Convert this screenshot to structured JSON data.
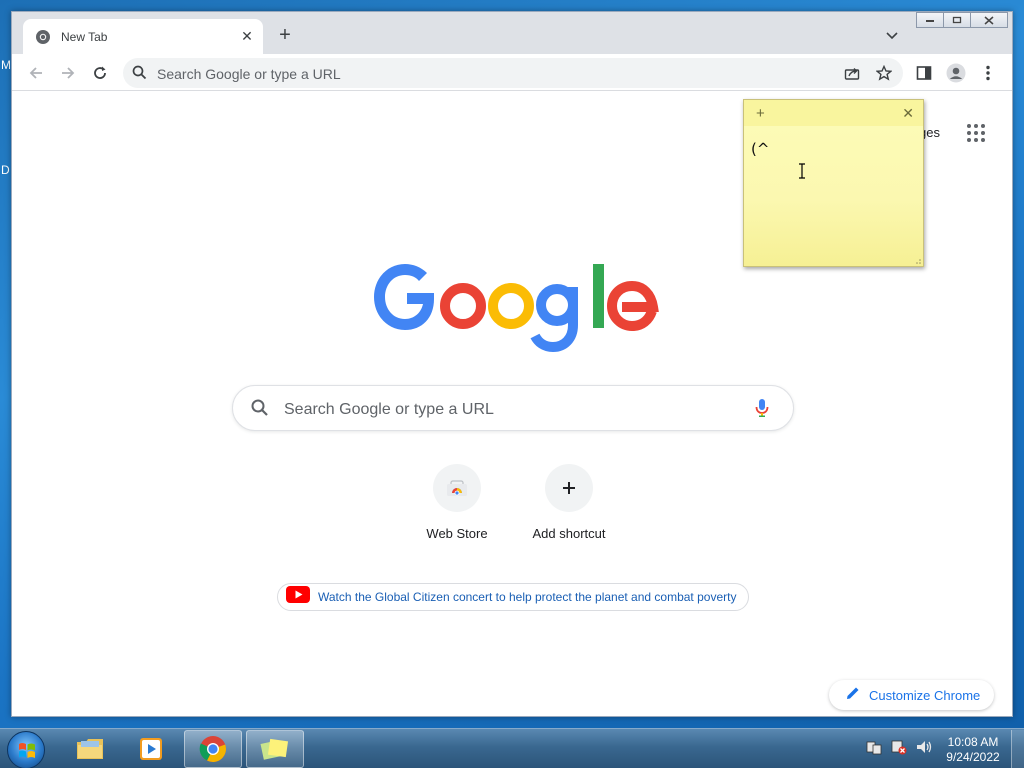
{
  "desktop": {
    "left_letters": [
      "M",
      "D"
    ]
  },
  "browser": {
    "tab": {
      "title": "New Tab"
    },
    "omnibox": {
      "placeholder": "Search Google or type a URL"
    },
    "window_controls": [
      "minimize",
      "restore",
      "close"
    ]
  },
  "newtab": {
    "images_link": "ges",
    "search": {
      "placeholder": "Search Google or type a URL"
    },
    "shortcuts": [
      {
        "label": "Web Store",
        "icon": "chrome-webstore-icon"
      },
      {
        "label": "Add shortcut",
        "icon": "plus-icon"
      }
    ],
    "promo": {
      "text": "Watch the Global Citizen concert to help protect the planet and combat poverty",
      "icon": "youtube-icon"
    },
    "customize": {
      "label": "Customize Chrome",
      "icon": "pencil-icon"
    }
  },
  "sticky_note": {
    "text": "(^"
  },
  "taskbar": {
    "items": [
      "windows-explorer",
      "media-player",
      "google-chrome",
      "sticky-notes"
    ],
    "active": "google-chrome",
    "clock": {
      "time": "10:08 AM",
      "date": "9/24/2022"
    }
  },
  "colors": {
    "google_blue": "#4285F4",
    "google_red": "#EA4335",
    "google_yellow": "#FBBC05",
    "google_green": "#34A853",
    "sticky_yellow": "#FDFCB8"
  }
}
